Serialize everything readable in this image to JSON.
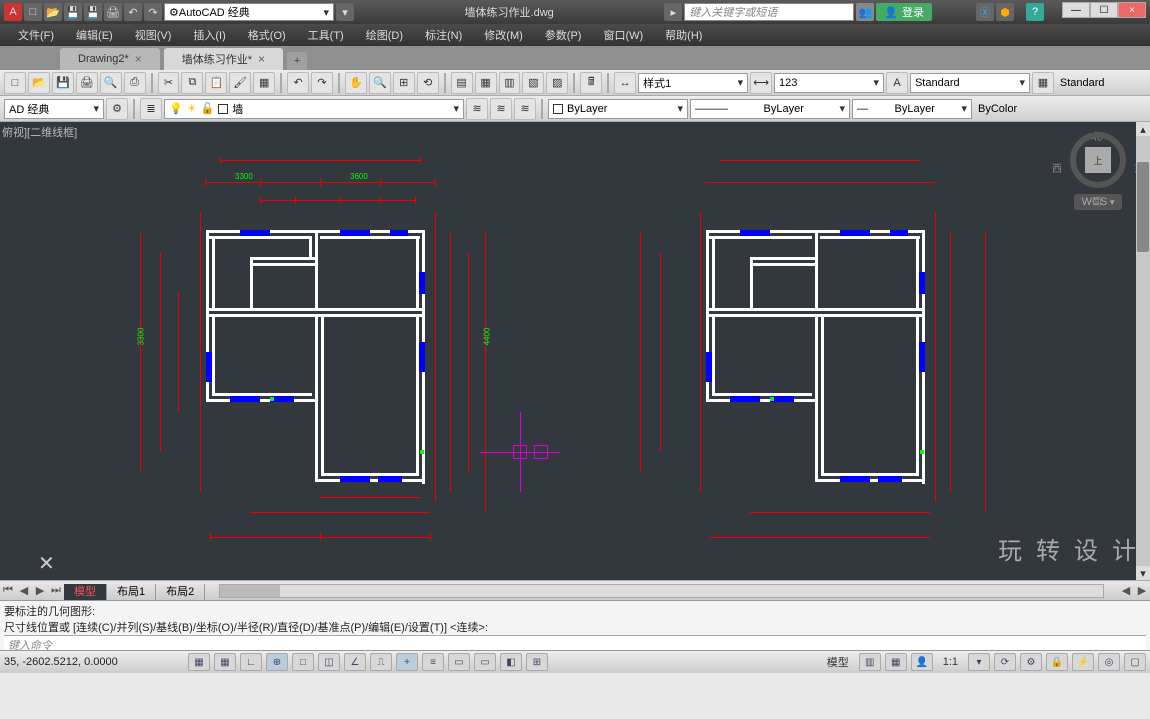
{
  "app": {
    "title": "墙体练习作业.dwg"
  },
  "workspace": "AutoCAD 经典",
  "search_placeholder": "键入关键字或短语",
  "login_label": "登录",
  "menu": [
    "文件(F)",
    "编辑(E)",
    "视图(V)",
    "插入(I)",
    "格式(O)",
    "工具(T)",
    "绘图(D)",
    "标注(N)",
    "修改(M)",
    "参数(P)",
    "窗口(W)",
    "帮助(H)"
  ],
  "doc_tabs": [
    {
      "label": "Drawing2*",
      "active": false
    },
    {
      "label": "墙体练习作业*",
      "active": true
    }
  ],
  "style_combo": "样式1",
  "dim_combo": "123",
  "textstyle_combo": "Standard",
  "tablestyle_combo": "Standard",
  "ws_small": "AD 经典",
  "layer_current": "墙",
  "color_combo": "ByLayer",
  "linetype_combo": "ByLayer",
  "lineweight_combo": "ByLayer",
  "plotstyle_combo": "ByColor",
  "viewport_label": "俯视][二维线框]",
  "nav": {
    "n": "北",
    "s": "南",
    "e": "东",
    "w": "西",
    "face": "上"
  },
  "wcs": "WCS",
  "watermark": "玩 转 设 计",
  "model_tabs": [
    "模型",
    "布局1",
    "布局2"
  ],
  "cmd_history": [
    "要标注的几何图形:",
    "尺寸线位置或 [连续(C)/并列(S)/基线(B)/坐标(O)/半径(R)/直径(D)/基准点(P)/编辑(E)/设置(T)] <连续>:"
  ],
  "cmd_prompt": "键入命令",
  "coords": "35, -2602.5212, 0.0000",
  "status_right": {
    "model": "模型",
    "scale": "1:1"
  }
}
